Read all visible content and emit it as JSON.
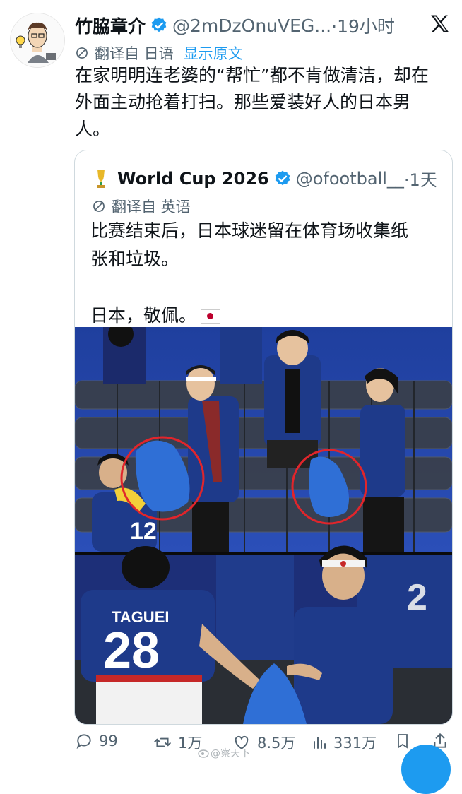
{
  "tweet": {
    "author_name": "竹脇章介",
    "handle": "@2mDzOnuVEG...",
    "time": "·19小时",
    "translated_from": "翻译自 日语",
    "show_original": "显示原文",
    "text_lines": [
      "在家明明连老婆的“帮忙”都不肯做清洁，却在",
      "外面主动抢着打扫。那些爱装好人的日本男",
      "人。"
    ]
  },
  "quote": {
    "name": "World Cup 2026",
    "handle": "@ofootball__",
    "time": "·1天",
    "translated_from": "翻译自 英语",
    "text_lines": [
      "比赛结束后，日本球迷留在体育场收集纸",
      "张和垃圾。"
    ],
    "closing": "日本，敬佩。",
    "jersey_top_name": "TAGUEI",
    "jersey_top_number": "28",
    "jersey_small_number": "12"
  },
  "actions": {
    "replies": "99",
    "reposts": "1万",
    "likes": "8.5万",
    "views": "331万"
  },
  "watermark": "@察天下",
  "colors": {
    "accent": "#1d9bf0",
    "jersey": "#1e3a8a",
    "bag": "#2f6fd6",
    "circle": "#e1252b",
    "seat": "#3a3f47"
  }
}
